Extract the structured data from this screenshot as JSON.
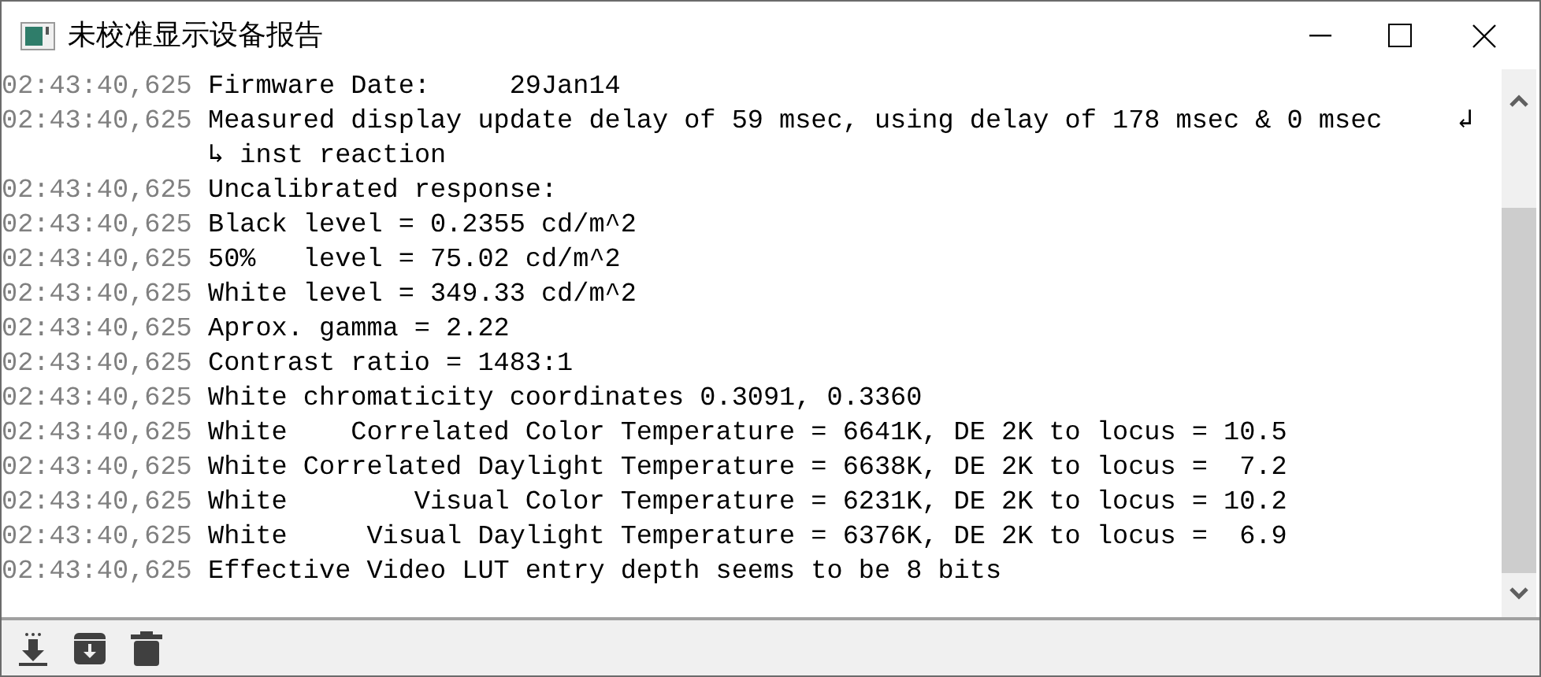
{
  "window": {
    "title": "未校准显示设备报告"
  },
  "log": [
    {
      "time": "02:43:40,625",
      "message": "Firmware Date:     29Jan14"
    },
    {
      "time": "02:43:40,625",
      "message": "Measured display update delay of 59 msec, using delay of 178 msec & 0 msec",
      "wrap_mark": "↲",
      "continuation": "↳ inst reaction"
    },
    {
      "time": "02:43:40,625",
      "message": "Uncalibrated response:"
    },
    {
      "time": "02:43:40,625",
      "message": "Black level = 0.2355 cd/m^2"
    },
    {
      "time": "02:43:40,625",
      "message": "50%   level = 75.02 cd/m^2"
    },
    {
      "time": "02:43:40,625",
      "message": "White level = 349.33 cd/m^2"
    },
    {
      "time": "02:43:40,625",
      "message": "Aprox. gamma = 2.22"
    },
    {
      "time": "02:43:40,625",
      "message": "Contrast ratio = 1483:1"
    },
    {
      "time": "02:43:40,625",
      "message": "White chromaticity coordinates 0.3091, 0.3360"
    },
    {
      "time": "02:43:40,625",
      "message": "White    Correlated Color Temperature = 6641K, DE 2K to locus = 10.5"
    },
    {
      "time": "02:43:40,625",
      "message": "White Correlated Daylight Temperature = 6638K, DE 2K to locus =  7.2"
    },
    {
      "time": "02:43:40,625",
      "message": "White        Visual Color Temperature = 6231K, DE 2K to locus = 10.2"
    },
    {
      "time": "02:43:40,625",
      "message": "White     Visual Daylight Temperature = 6376K, DE 2K to locus =  6.9"
    },
    {
      "time": "02:43:40,625",
      "message": "Effective Video LUT entry depth seems to be 8 bits"
    }
  ]
}
